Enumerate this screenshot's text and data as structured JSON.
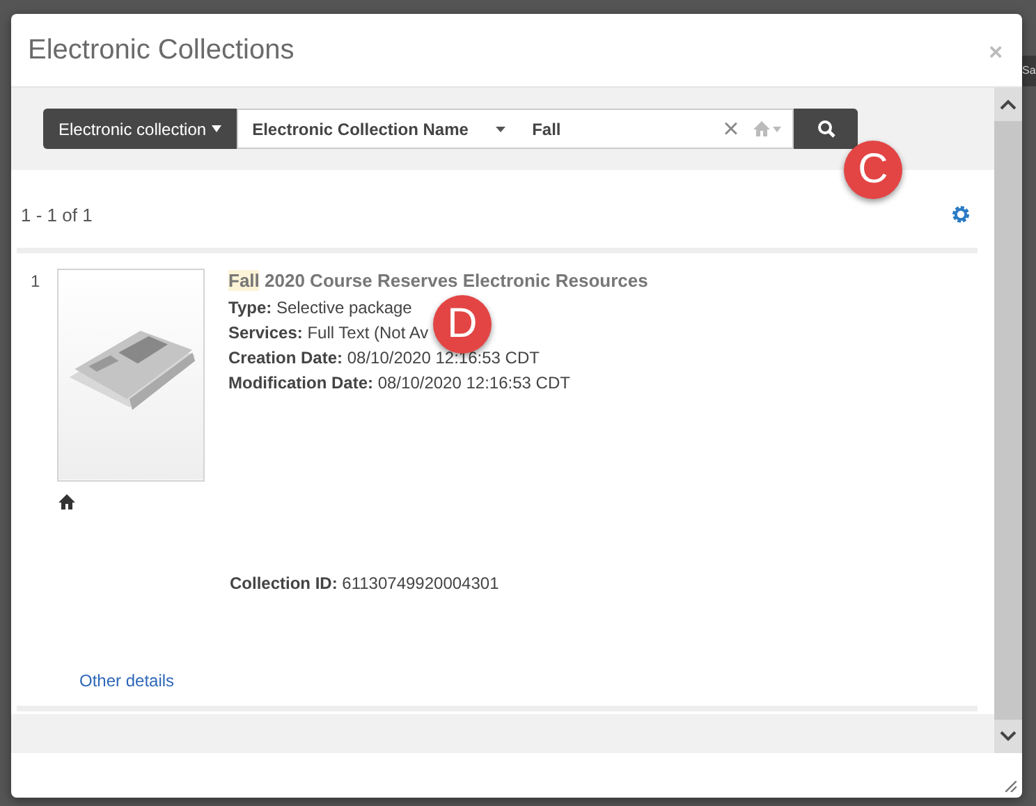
{
  "background": {
    "button_partial": "Sa"
  },
  "dialog": {
    "title": "Electronic Collections",
    "close": "×"
  },
  "search": {
    "scope": "Electronic collection",
    "field": "Electronic Collection Name",
    "value": "Fall",
    "clear": "×"
  },
  "results": {
    "count": "1 - 1 of 1",
    "items": [
      {
        "number": "1",
        "title_parts": [
          {
            "text": "Fall",
            "highlighted": true
          },
          {
            "text": " 2020 Course Reserves Electronic Resources",
            "highlighted": false
          }
        ],
        "fields": [
          {
            "label": "Type:",
            "value": "Selective package"
          },
          {
            "label": "Services:",
            "value": "Full Text (Not Av"
          },
          {
            "label": "Creation Date:",
            "value": "08/10/2020 12:16:53 CDT"
          },
          {
            "label": "Modification Date:",
            "value": "08/10/2020 12:16:53 CDT"
          }
        ],
        "collection_id": {
          "label": "Collection ID:",
          "value": "61130749920004301"
        },
        "link": "Other details"
      }
    ]
  },
  "annotations": [
    {
      "label": "C"
    },
    {
      "label": "D"
    }
  ]
}
